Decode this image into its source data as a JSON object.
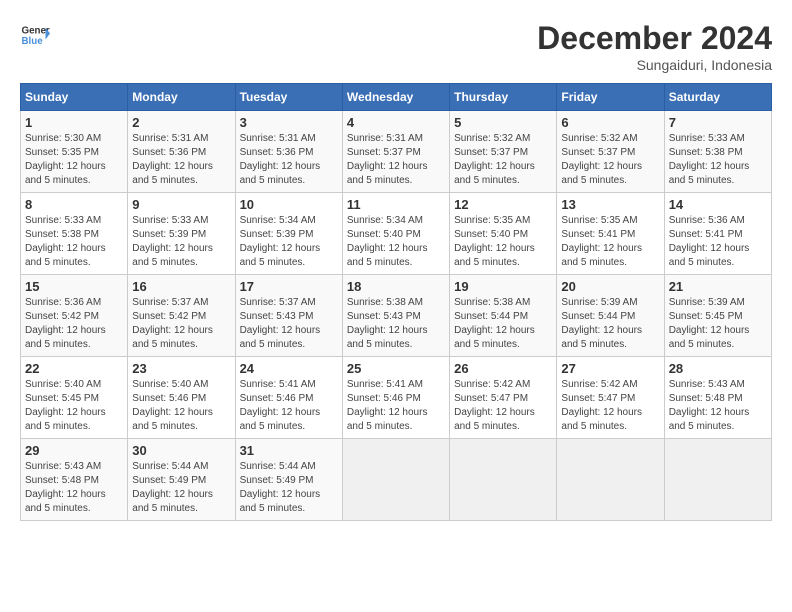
{
  "header": {
    "logo_general": "General",
    "logo_blue": "Blue",
    "month": "December 2024",
    "location": "Sungaiduri, Indonesia"
  },
  "weekdays": [
    "Sunday",
    "Monday",
    "Tuesday",
    "Wednesday",
    "Thursday",
    "Friday",
    "Saturday"
  ],
  "weeks": [
    [
      {
        "day": "1",
        "sunrise": "5:30 AM",
        "sunset": "5:35 PM",
        "daylight": "12 hours and 5 minutes."
      },
      {
        "day": "2",
        "sunrise": "5:31 AM",
        "sunset": "5:36 PM",
        "daylight": "12 hours and 5 minutes."
      },
      {
        "day": "3",
        "sunrise": "5:31 AM",
        "sunset": "5:36 PM",
        "daylight": "12 hours and 5 minutes."
      },
      {
        "day": "4",
        "sunrise": "5:31 AM",
        "sunset": "5:37 PM",
        "daylight": "12 hours and 5 minutes."
      },
      {
        "day": "5",
        "sunrise": "5:32 AM",
        "sunset": "5:37 PM",
        "daylight": "12 hours and 5 minutes."
      },
      {
        "day": "6",
        "sunrise": "5:32 AM",
        "sunset": "5:37 PM",
        "daylight": "12 hours and 5 minutes."
      },
      {
        "day": "7",
        "sunrise": "5:33 AM",
        "sunset": "5:38 PM",
        "daylight": "12 hours and 5 minutes."
      }
    ],
    [
      {
        "day": "8",
        "sunrise": "5:33 AM",
        "sunset": "5:38 PM",
        "daylight": "12 hours and 5 minutes."
      },
      {
        "day": "9",
        "sunrise": "5:33 AM",
        "sunset": "5:39 PM",
        "daylight": "12 hours and 5 minutes."
      },
      {
        "day": "10",
        "sunrise": "5:34 AM",
        "sunset": "5:39 PM",
        "daylight": "12 hours and 5 minutes."
      },
      {
        "day": "11",
        "sunrise": "5:34 AM",
        "sunset": "5:40 PM",
        "daylight": "12 hours and 5 minutes."
      },
      {
        "day": "12",
        "sunrise": "5:35 AM",
        "sunset": "5:40 PM",
        "daylight": "12 hours and 5 minutes."
      },
      {
        "day": "13",
        "sunrise": "5:35 AM",
        "sunset": "5:41 PM",
        "daylight": "12 hours and 5 minutes."
      },
      {
        "day": "14",
        "sunrise": "5:36 AM",
        "sunset": "5:41 PM",
        "daylight": "12 hours and 5 minutes."
      }
    ],
    [
      {
        "day": "15",
        "sunrise": "5:36 AM",
        "sunset": "5:42 PM",
        "daylight": "12 hours and 5 minutes."
      },
      {
        "day": "16",
        "sunrise": "5:37 AM",
        "sunset": "5:42 PM",
        "daylight": "12 hours and 5 minutes."
      },
      {
        "day": "17",
        "sunrise": "5:37 AM",
        "sunset": "5:43 PM",
        "daylight": "12 hours and 5 minutes."
      },
      {
        "day": "18",
        "sunrise": "5:38 AM",
        "sunset": "5:43 PM",
        "daylight": "12 hours and 5 minutes."
      },
      {
        "day": "19",
        "sunrise": "5:38 AM",
        "sunset": "5:44 PM",
        "daylight": "12 hours and 5 minutes."
      },
      {
        "day": "20",
        "sunrise": "5:39 AM",
        "sunset": "5:44 PM",
        "daylight": "12 hours and 5 minutes."
      },
      {
        "day": "21",
        "sunrise": "5:39 AM",
        "sunset": "5:45 PM",
        "daylight": "12 hours and 5 minutes."
      }
    ],
    [
      {
        "day": "22",
        "sunrise": "5:40 AM",
        "sunset": "5:45 PM",
        "daylight": "12 hours and 5 minutes."
      },
      {
        "day": "23",
        "sunrise": "5:40 AM",
        "sunset": "5:46 PM",
        "daylight": "12 hours and 5 minutes."
      },
      {
        "day": "24",
        "sunrise": "5:41 AM",
        "sunset": "5:46 PM",
        "daylight": "12 hours and 5 minutes."
      },
      {
        "day": "25",
        "sunrise": "5:41 AM",
        "sunset": "5:46 PM",
        "daylight": "12 hours and 5 minutes."
      },
      {
        "day": "26",
        "sunrise": "5:42 AM",
        "sunset": "5:47 PM",
        "daylight": "12 hours and 5 minutes."
      },
      {
        "day": "27",
        "sunrise": "5:42 AM",
        "sunset": "5:47 PM",
        "daylight": "12 hours and 5 minutes."
      },
      {
        "day": "28",
        "sunrise": "5:43 AM",
        "sunset": "5:48 PM",
        "daylight": "12 hours and 5 minutes."
      }
    ],
    [
      {
        "day": "29",
        "sunrise": "5:43 AM",
        "sunset": "5:48 PM",
        "daylight": "12 hours and 5 minutes."
      },
      {
        "day": "30",
        "sunrise": "5:44 AM",
        "sunset": "5:49 PM",
        "daylight": "12 hours and 5 minutes."
      },
      {
        "day": "31",
        "sunrise": "5:44 AM",
        "sunset": "5:49 PM",
        "daylight": "12 hours and 5 minutes."
      },
      null,
      null,
      null,
      null
    ]
  ],
  "labels": {
    "sunrise": "Sunrise:",
    "sunset": "Sunset:",
    "daylight": "Daylight:"
  }
}
